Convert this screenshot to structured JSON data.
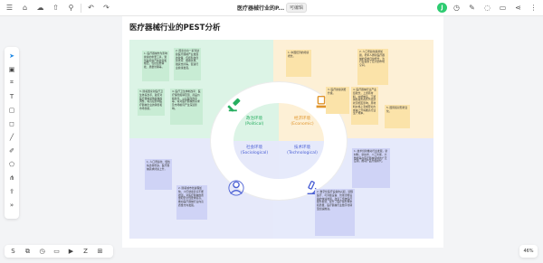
{
  "topbar": {
    "title": "医疗器械行业的P...",
    "edit_badge": "可编辑",
    "left_icons": [
      "menu-icon",
      "save-icon",
      "cloud-icon",
      "share-icon",
      "search-icon",
      "undo-icon",
      "redo-icon"
    ],
    "right_icons": [
      "clock-icon",
      "brush-icon",
      "comment-icon",
      "chat-icon",
      "share-icon",
      "more-icon"
    ],
    "avatar_initial": "J"
  },
  "left_toolbar": {
    "tools": [
      "select-icon",
      "frame-icon",
      "grid-icon",
      "text-icon",
      "sticky-note-icon",
      "shape-icon",
      "line-icon",
      "pen-icon",
      "circle-icon",
      "mindmap-icon",
      "upload-icon",
      "more-icon"
    ]
  },
  "canvas": {
    "title": "医疗器械行业的PEST分析",
    "segments": {
      "political": {
        "zh": "政治环境",
        "en": "(Political)"
      },
      "economic": {
        "zh": "经济环境",
        "en": "(Economic)"
      },
      "social": {
        "zh": "社会环境",
        "en": "(Sociological)"
      },
      "technological": {
        "zh": "技术环境",
        "en": "(Technological)"
      }
    },
    "notes": {
      "political": [
        "1. 医疗器械作为影响健康的重要工具，受到政府的严格监管和规范，包括注册审批、质量管理等。",
        "2. 国家出台一系列鼓励医疗器械产业发展的政策，包括科技创新支持、税收优惠、融资支持等，促进行业健康发展。",
        "3. 随着国家对医疗卫生体系改革，政府对医疗器械采购政策的调整，将直接影响医疗器械企业的销售和市场份额。",
        "4. 医疗卫生体制改革：医疗保险报销范围、药品价格改革、公立医院改革等，将对医疗器械的需求及市场格局产生深远影响。"
      ],
      "economic": [
        "1. 中国经济的持续增长。",
        "2. 人口老龄化趋势加剧，老年人群对医疗器械的需求日益增长，为行业提供了巨大的市场空间。",
        "3. 医疗健康消费升级。",
        "4. 医疗器械行业产业链较长，上游原材料、中游制造、下游销售服务各环节经济状况相互影响，原材料价格上涨或劳动力成本上升将推高行业生产成本。",
        "5. 国际贸易形势变化。"
      ],
      "social": [
        "1. 人口老龄化、慢性病患者增多，医疗器械需求持续上升。",
        "2. 随着城市化进程加快，人们健康意识不断增强，对医疗器械的质量和安全性要求提高，推动医疗器械行业向高质量方向发展。"
      ],
      "technological": [
        "1. 技术创新推动行业发展，新材料、新技术、人工智能、大数据等在医疗器械领域的广泛应用，推动产品升级换代。",
        "2. 数字化医疗设备的兴起，远程医疗、可穿戴设备、智能诊断设备的快速发展，改变了传统医疗服务模式，提升了医疗服务效率和质量，医疗器械行业数字化转型加速推进。"
      ]
    }
  },
  "bottom_toolbar": {
    "tools": [
      "shape-icon",
      "layers-icon",
      "history-icon",
      "comment-icon",
      "present-icon",
      "zoom-fit-icon",
      "grid-icon"
    ]
  },
  "zoom": {
    "level": "46%"
  }
}
